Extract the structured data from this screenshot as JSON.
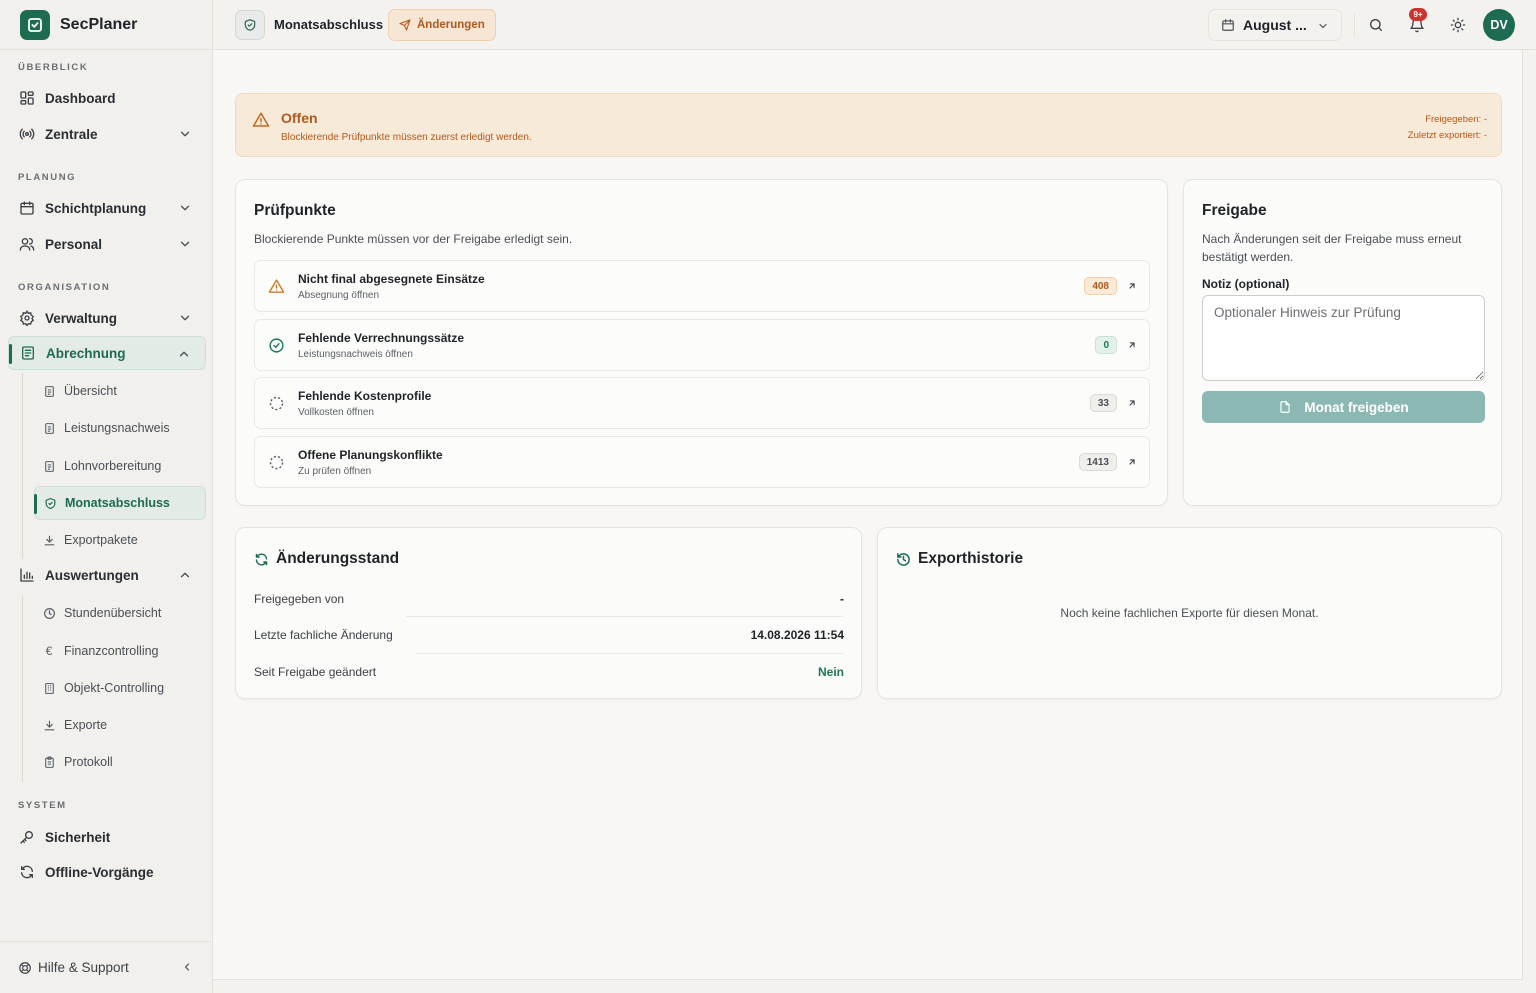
{
  "brand": {
    "name": "SecPlaner"
  },
  "sidebar": {
    "sections": {
      "overview": "ÜBERBLICK",
      "planning": "PLANUNG",
      "organisation": "ORGANISATION",
      "system": "SYSTEM"
    },
    "items": {
      "dashboard": "Dashboard",
      "zentrale": "Zentrale",
      "schichtplanung": "Schichtplanung",
      "personal": "Personal",
      "verwaltung": "Verwaltung",
      "abrechnung": "Abrechnung",
      "auswertungen": "Auswertungen",
      "sicherheit": "Sicherheit",
      "offline": "Offline-Vorgänge"
    },
    "abrechnung_sub": [
      "Übersicht",
      "Leistungsnachweis",
      "Lohnvorbereitung",
      "Monatsabschluss",
      "Exportpakete"
    ],
    "auswertungen_sub": [
      "Stundenübersicht",
      "Finanzcontrolling",
      "Objekt-Controlling",
      "Exporte",
      "Protokoll"
    ],
    "footer": "Hilfe & Support"
  },
  "header": {
    "title": "Monatsabschluss",
    "badge": "Änderungen",
    "month": "August ...",
    "notifications": "9+",
    "avatar": "DV"
  },
  "alert": {
    "title": "Offen",
    "text": "Blockierende Prüfpunkte müssen zuerst erledigt werden.",
    "released": "Freigegeben: -",
    "exported": "Zuletzt exportiert: -"
  },
  "checks": {
    "title": "Prüfpunkte",
    "subtitle": "Blockierende Punkte müssen vor der Freigabe erledigt sein.",
    "items": [
      {
        "title": "Nicht final abgesegnete Einsätze",
        "sub": "Absegnung öffnen",
        "count": "408",
        "status": "warning"
      },
      {
        "title": "Fehlende Verrechnungssätze",
        "sub": "Leistungsnachweis öffnen",
        "count": "0",
        "status": "ok"
      },
      {
        "title": "Fehlende Kostenprofile",
        "sub": "Vollkosten öffnen",
        "count": "33",
        "status": "pending"
      },
      {
        "title": "Offene Planungskonflikte",
        "sub": "Zu prüfen öffnen",
        "count": "1413",
        "status": "pending"
      }
    ]
  },
  "release": {
    "title": "Freigabe",
    "subtitle": "Nach Änderungen seit der Freigabe muss erneut bestätigt werden.",
    "note_label": "Notiz (optional)",
    "note_placeholder": "Optionaler Hinweis zur Prüfung",
    "note_value": "",
    "button": "Monat freigeben"
  },
  "changes": {
    "title": "Änderungsstand",
    "rows": [
      {
        "label": "Freigegeben von",
        "value": "-"
      },
      {
        "label": "Letzte fachliche Änderung",
        "value": "14.08.2026 11:54"
      },
      {
        "label": "Seit Freigabe geändert",
        "value": "Nein"
      }
    ]
  },
  "exports": {
    "title": "Exporthistorie",
    "empty": "Noch keine fachlichen Exporte für diesen Monat."
  },
  "colors": {
    "brand": "#1d6b51",
    "warning": "#b3591c",
    "ok": "#1d7a53",
    "button_disabled": "#8cb8b4"
  }
}
